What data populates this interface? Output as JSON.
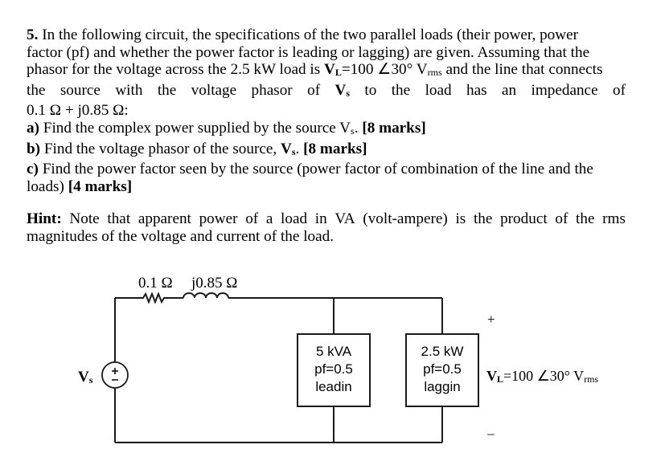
{
  "question": {
    "number": "5.",
    "intro_lines": [
      "In the following circuit, the specifications of the two parallel loads (their power, power",
      "factor (pf) and whether the power factor is leading or lagging) are given. Assuming that the",
      "phasor for the voltage across the 2.5 kW load is ",
      "the source with the voltage phasor of ",
      "0.1 Ω + j0.85 Ω:"
    ],
    "vl_symbol": "V",
    "vl_sub": "L",
    "vl_value": "=100 ∠30° V",
    "vl_unit_sub": "rms",
    "intro_line3_tail": " and the line that connects",
    "vs_symbol": "V",
    "vs_sub": "s",
    "intro_line4_tail": " to the load has an impedance of",
    "parts": [
      {
        "label": "a)",
        "text": " Find the complex power supplied by the source V",
        "sub": "s",
        "after": ". ",
        "marks": "[8 marks]"
      },
      {
        "label": "b)",
        "text": " Find the voltage phasor of the source, ",
        "bold_sym": "V",
        "bold_sub": "s",
        "after": ". ",
        "marks": "[8 marks]"
      },
      {
        "label": "c)",
        "text": " Find the power factor seen by the source (power factor of combination of the line and the",
        "text2": "loads) ",
        "marks": "[4 marks]"
      }
    ]
  },
  "hint": {
    "label": "Hint:",
    "line1": " Note that apparent power of a load in VA (volt-ampere) is the product of the rms",
    "line2": "magnitudes of the voltage and current of the load."
  },
  "circuit": {
    "resistor_label": "0.1 Ω",
    "inductor_label": "j0.85 Ω",
    "source_label": "V",
    "source_label_sub": "s",
    "load1": {
      "line1": "5 kVA",
      "line2": "pf=0.5",
      "line3": "leadin"
    },
    "load2": {
      "line1": "2.5 kW",
      "line2": "pf=0.5",
      "line3": "laggin"
    },
    "plus_sign": "+",
    "minus_sign": "–",
    "vl_label": "V",
    "vl_label_sub": "L",
    "vl_label_value": "=100 ∠30° V",
    "vl_label_unit_sub": "rms"
  }
}
